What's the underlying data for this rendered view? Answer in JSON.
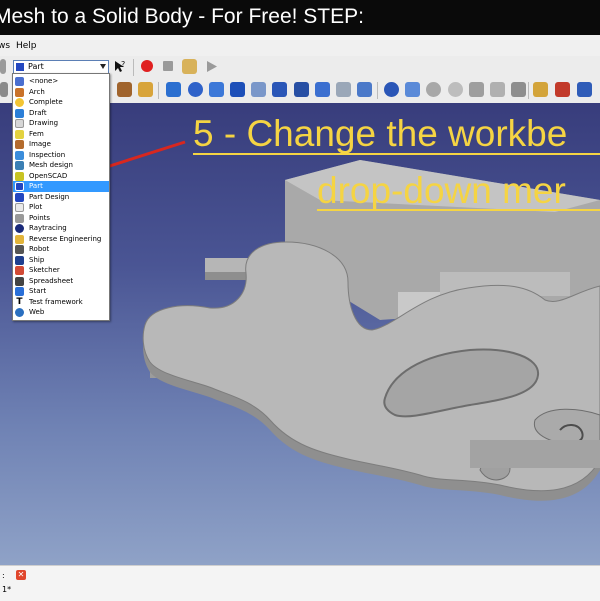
{
  "title_text": "Mesh to a Solid Body - For Free!   STEP:",
  "menubar": {
    "items": [
      "ws",
      "Help"
    ]
  },
  "workbench_combo": {
    "value": "Part"
  },
  "workbench_list": [
    {
      "label": "<none>",
      "color": "#4a6fd0"
    },
    {
      "label": "Arch",
      "color": "#c9722a"
    },
    {
      "label": "Complete",
      "color": "#f3c534"
    },
    {
      "label": "Draft",
      "color": "#2b7fd8"
    },
    {
      "label": "Drawing",
      "color": "#d7d7d7"
    },
    {
      "label": "Fem",
      "color": "#e3d23f"
    },
    {
      "label": "Image",
      "color": "#b46b2d"
    },
    {
      "label": "Inspection",
      "color": "#3b8ddb"
    },
    {
      "label": "Mesh design",
      "color": "#3b7fb4"
    },
    {
      "label": "OpenSCAD",
      "color": "#c8c322"
    },
    {
      "label": "Part",
      "color": "#2347c0"
    },
    {
      "label": "Part Design",
      "color": "#2347c0"
    },
    {
      "label": "Plot",
      "color": "#e9e9e9"
    },
    {
      "label": "Points",
      "color": "#999999"
    },
    {
      "label": "Raytracing",
      "color": "#1a2a7a"
    },
    {
      "label": "Reverse Engineering",
      "color": "#e2b43a"
    },
    {
      "label": "Robot",
      "color": "#555555"
    },
    {
      "label": "Ship",
      "color": "#1f3f8f"
    },
    {
      "label": "Sketcher",
      "color": "#d24a35"
    },
    {
      "label": "Spreadsheet",
      "color": "#444444"
    },
    {
      "label": "Start",
      "color": "#2a6fd8"
    },
    {
      "label": "Test framework",
      "color": "#111111"
    },
    {
      "label": "Web",
      "color": "#2a6fc0"
    }
  ],
  "selected_workbench": "Part",
  "overlay": {
    "line1": "5 - Change the workbe",
    "line2": "drop-down mer"
  },
  "status": {
    "tab_label": ": 1*"
  },
  "colors": {
    "accent_text": "#f5d443",
    "arrow": "#d8271f",
    "selection": "#3399ff"
  }
}
